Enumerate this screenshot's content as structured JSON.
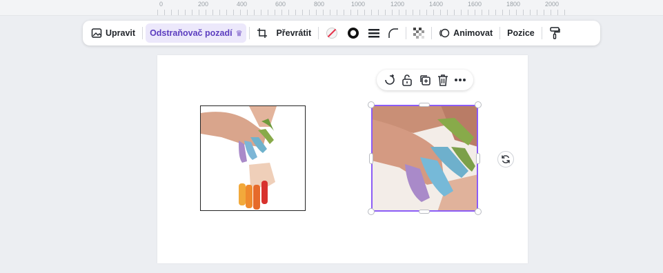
{
  "ruler": {
    "labels": [
      "0",
      "200",
      "400",
      "600",
      "800",
      "1000",
      "1200",
      "1400",
      "1600",
      "1800",
      "2000"
    ]
  },
  "toolbar": {
    "edit_label": "Upravit",
    "bg_remove_label": "Odstraňovač pozadí",
    "flip_label": "Převrátit",
    "animate_label": "Animovat",
    "position_label": "Pozice"
  },
  "colors": {
    "accent": "#8b5cf6",
    "active_bg": "#ece8fb",
    "canvas_bg": "#ffffff",
    "workspace_bg": "#eceef2"
  },
  "icons": {
    "edit": "image-edit-icon",
    "crown": "crown-icon",
    "crop": "crop-icon",
    "border_none": "no-border-icon",
    "border_style": "circle-border-icon",
    "border_weight": "lines-icon",
    "corner": "corner-radius-icon",
    "transparency": "checkerboard-icon",
    "animate": "animate-icon",
    "paint": "paint-roller-icon",
    "ai_edit": "lasso-sparkle-icon",
    "lock": "lock-icon",
    "duplicate": "duplicate-icon",
    "delete": "trash-icon",
    "more": "more-icon",
    "rotate": "rotate-icon"
  }
}
